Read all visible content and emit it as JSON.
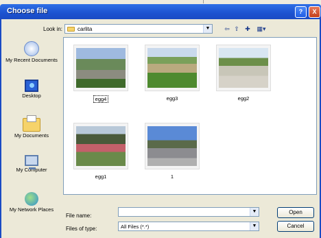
{
  "window": {
    "title": "Choose file",
    "help_glyph": "?",
    "close_glyph": "X"
  },
  "toolbar": {
    "look_in_label": "Look in:",
    "look_in_value": "carlita",
    "icons": [
      "back-arrow-icon",
      "up-folder-icon",
      "new-folder-icon",
      "views-menu-icon"
    ]
  },
  "places": [
    {
      "label": "My Recent Documents",
      "icon": "recent-documents-icon"
    },
    {
      "label": "Desktop",
      "icon": "desktop-icon"
    },
    {
      "label": "My Documents",
      "icon": "my-documents-icon"
    },
    {
      "label": "My Computer",
      "icon": "my-computer-icon"
    },
    {
      "label": "My Network Places",
      "icon": "network-places-icon"
    }
  ],
  "files": [
    {
      "name": "egg4",
      "selected": true
    },
    {
      "name": "egg3",
      "selected": false
    },
    {
      "name": "egg2",
      "selected": false
    },
    {
      "name": "egg1",
      "selected": false
    },
    {
      "name": "1",
      "selected": false
    }
  ],
  "footer": {
    "file_name_label": "File name:",
    "file_name_value": "",
    "file_type_label": "Files of type:",
    "file_type_value": "All Files (*.*)",
    "open_label": "Open",
    "cancel_label": "Cancel"
  },
  "colors": {
    "titlebar": "#1c52d0",
    "dialog_bg": "#ece9d8",
    "border": "#7f9db9"
  }
}
